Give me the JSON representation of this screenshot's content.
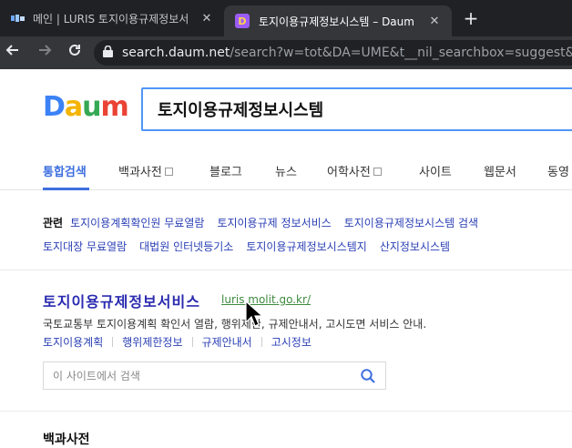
{
  "browser": {
    "tabs": [
      {
        "title": "메인 | LURIS 토지이용규제정보서"
      },
      {
        "title": "토지이용규제정보시스템 – Daum"
      }
    ],
    "tab_close": "✕",
    "new_tab": "+",
    "url_host": "search.daum.net",
    "url_rest": "/search?w=tot&DA=UME&t__nil_searchbox=suggest&sug="
  },
  "daum": {
    "logo": [
      "D",
      "a",
      "u",
      "m"
    ],
    "query": "토지이용규제정보시스템"
  },
  "nav_tabs": [
    {
      "label": "통합검색",
      "checkbox": false,
      "active": true
    },
    {
      "label": "백과사전",
      "checkbox": true,
      "active": false
    },
    {
      "label": "블로그",
      "checkbox": false,
      "active": false
    },
    {
      "label": "뉴스",
      "checkbox": false,
      "active": false
    },
    {
      "label": "어학사전",
      "checkbox": true,
      "active": false
    },
    {
      "label": "사이트",
      "checkbox": false,
      "active": false
    },
    {
      "label": "웹문서",
      "checkbox": false,
      "active": false
    },
    {
      "label": "동영",
      "checkbox": false,
      "active": false
    }
  ],
  "related": {
    "label": "관련",
    "links": [
      "토지이용계획확인원 무료열람",
      "토지이용규제 정보서비스",
      "토지이용규제정보시스템 검색",
      "토지대장 무료열람",
      "대법원 인터넷등기소",
      "토지이용규제정보시스템지",
      "산지정보시스템"
    ]
  },
  "result": {
    "title": "토지이용규제정보서비스",
    "url": "luris.molit.go.kr/",
    "description": "국토교통부 토지이용계획 확인서 열람, 행위제한, 규제안내서, 고시도면 서비스 안내.",
    "sitelinks": [
      "토지이용계획",
      "행위제한정보",
      "규제안내서",
      "고시정보"
    ],
    "site_search_placeholder": "이 사이트에서 검색"
  },
  "next_section": "백과사전",
  "colors": {
    "accent": "#3e6fe0",
    "link": "#2a3fb5",
    "url_green": "#3f8a3f"
  }
}
